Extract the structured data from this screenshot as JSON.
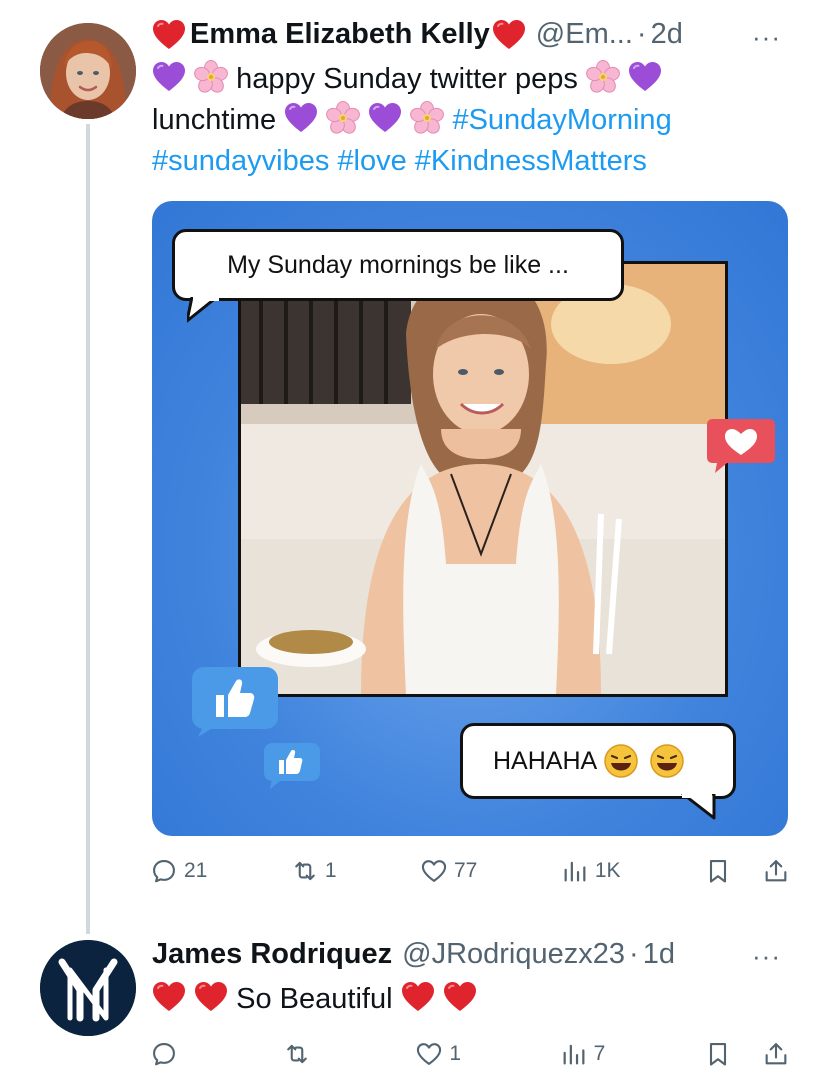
{
  "tweet1": {
    "name": "Emma Elizabeth Kelly",
    "handle": "@Em...",
    "sep": "·",
    "time": "2d",
    "more": "···",
    "text_line1": "happy Sunday twitter peps",
    "text_line2_word": "lunchtime",
    "hashtags_line2": [
      "#SundayMorning"
    ],
    "hashtags_line3": [
      "#sundayvibes",
      "#love",
      "#KindnessMatters"
    ],
    "media": {
      "bubble_top": "My Sunday mornings be like ...",
      "bubble_bottom": "HAHAHA"
    },
    "actions": {
      "replies": "21",
      "retweets": "1",
      "likes": "77",
      "views": "1K"
    }
  },
  "tweet2": {
    "name": "James Rodriquez",
    "handle": "@JRodriquezx23",
    "sep": "·",
    "time": "1d",
    "more": "···",
    "text": "So Beautiful",
    "actions": {
      "replies": "",
      "retweets": "",
      "likes": "1",
      "views": "7"
    }
  },
  "colors": {
    "link": "#1d9bf0",
    "muted": "#536471",
    "media_blue": "#3f83dd",
    "heart_red": "#e0242e",
    "purple_heart": "#9b4dd8"
  },
  "icons": [
    "red-heart-emoji",
    "purple-heart-emoji",
    "cherry-blossom-emoji",
    "reply-icon",
    "retweet-icon",
    "like-icon",
    "views-icon",
    "bookmark-icon",
    "share-icon",
    "more-icon",
    "yankees-logo"
  ]
}
